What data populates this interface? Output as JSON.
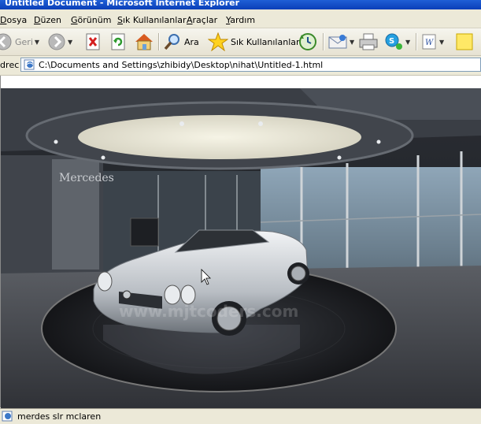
{
  "window": {
    "title": "Untitled Document - Microsoft Internet Explorer"
  },
  "menu": [
    {
      "underline": "D",
      "rest": "osya"
    },
    {
      "underline": "D",
      "rest": "üzen"
    },
    {
      "underline": "G",
      "rest": "örünüm"
    },
    {
      "underline": "S",
      "rest": "ık Kullanılanlar"
    },
    {
      "underline": "A",
      "rest": "raçlar"
    },
    {
      "underline": "Y",
      "rest": "ardım"
    }
  ],
  "toolbar": {
    "back_label": "Geri",
    "search_label": "Ara",
    "favorites_label": "Sık Kullanılanlar"
  },
  "address": {
    "label": "drес",
    "value": "C:\\Documents and Settings\\zhibidy\\Desktop\\nihat\\Untitled-1.html"
  },
  "page": {
    "image_alt": "merdes slr mclaren",
    "watermark": "www.mjtcoders.com",
    "wall_sign": "Mercedes"
  },
  "status": {
    "text": "merdes slr mclaren"
  }
}
